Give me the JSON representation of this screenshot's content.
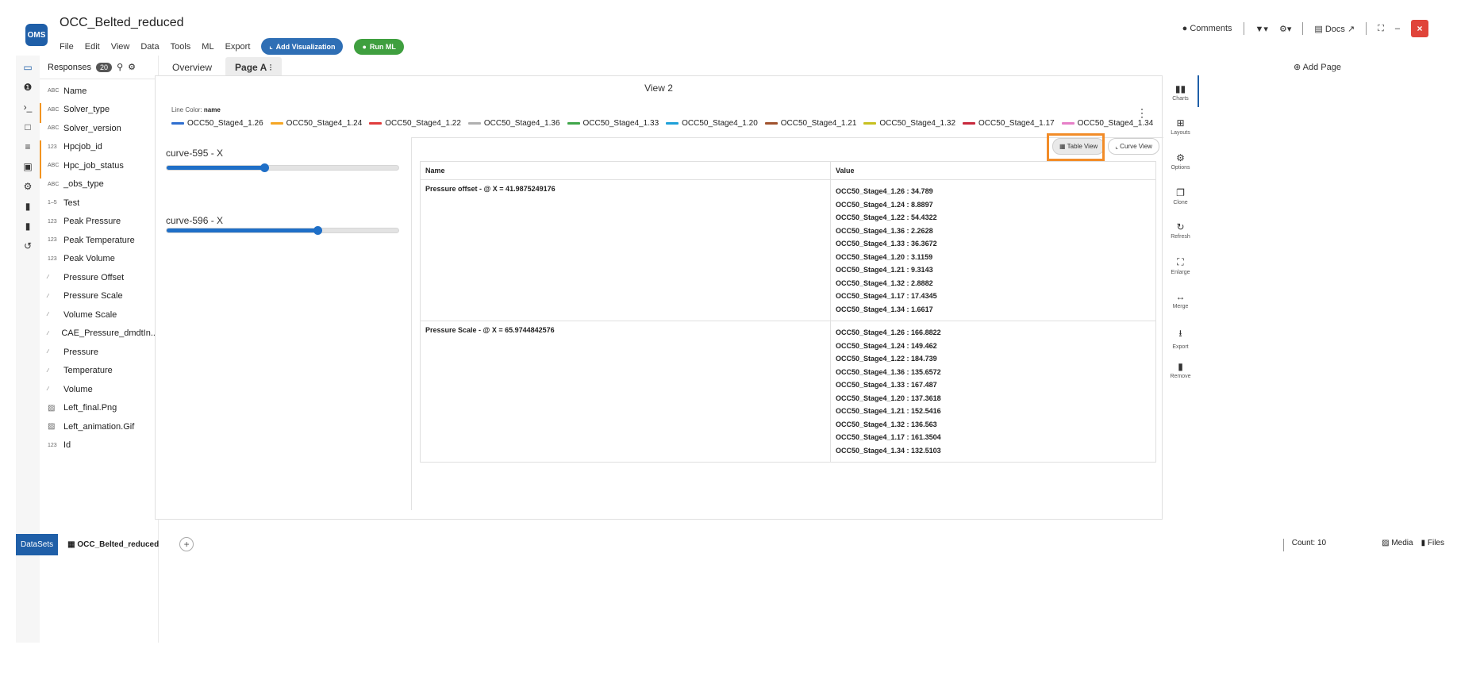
{
  "app": {
    "title": "OCC_Belted_reduced",
    "logo": "OMS"
  },
  "menu": [
    "File",
    "Edit",
    "View",
    "Data",
    "Tools",
    "ML",
    "Export"
  ],
  "header_buttons": {
    "add_visualization": "Add Visualization",
    "run_ml": "Run ML"
  },
  "top_right": {
    "comments": "Comments",
    "docs": "Docs"
  },
  "rail_icons": [
    "monitor-icon",
    "info-icon",
    "terminal-icon",
    "square-icon",
    "sliders-icon",
    "image-icon",
    "gear-icon",
    "file-icon",
    "file-icon",
    "history-icon"
  ],
  "fields_panel": {
    "label": "Responses",
    "count": "20",
    "items": [
      {
        "type": "ABC",
        "name": "Name"
      },
      {
        "type": "ABC",
        "name": "Solver_type"
      },
      {
        "type": "ABC",
        "name": "Solver_version"
      },
      {
        "type": "123",
        "name": "Hpcjob_id"
      },
      {
        "type": "ABC",
        "name": "Hpc_job_status"
      },
      {
        "type": "ABC",
        "name": "_obs_type"
      },
      {
        "type": "1–5",
        "name": "Test"
      },
      {
        "type": "123",
        "name": "Peak Pressure"
      },
      {
        "type": "123",
        "name": "Peak Temperature"
      },
      {
        "type": "123",
        "name": "Peak Volume"
      },
      {
        "type": "∕",
        "name": "Pressure Offset"
      },
      {
        "type": "∕",
        "name": "Pressure Scale"
      },
      {
        "type": "∕",
        "name": "Volume Scale"
      },
      {
        "type": "∕",
        "name": "CAE_Pressure_dmdtIn..."
      },
      {
        "type": "∕",
        "name": "Pressure"
      },
      {
        "type": "∕",
        "name": "Temperature"
      },
      {
        "type": "∕",
        "name": "Volume"
      },
      {
        "type": "img",
        "name": "Left_final.Png"
      },
      {
        "type": "img",
        "name": "Left_animation.Gif"
      },
      {
        "type": "123",
        "name": "Id"
      }
    ]
  },
  "tabs": [
    "Overview",
    "Page A"
  ],
  "add_page": "Add Page",
  "view": {
    "title": "View 2",
    "legend_caption_prefix": "Line Color:",
    "legend_caption_field": "name",
    "legend": [
      {
        "label": "OCC50_Stage4_1.26",
        "color": "#2f6fd0"
      },
      {
        "label": "OCC50_Stage4_1.24",
        "color": "#f5a623"
      },
      {
        "label": "OCC50_Stage4_1.22",
        "color": "#e03c3c"
      },
      {
        "label": "OCC50_Stage4_1.36",
        "color": "#b0b0b0"
      },
      {
        "label": "OCC50_Stage4_1.33",
        "color": "#3fa64a"
      },
      {
        "label": "OCC50_Stage4_1.20",
        "color": "#1ea0d8"
      },
      {
        "label": "OCC50_Stage4_1.21",
        "color": "#a0522d"
      },
      {
        "label": "OCC50_Stage4_1.32",
        "color": "#c8c020"
      },
      {
        "label": "OCC50_Stage4_1.17",
        "color": "#c8283c"
      },
      {
        "label": "OCC50_Stage4_1.34",
        "color": "#e67fc8"
      }
    ],
    "sliders": [
      {
        "label": "curve-595 - X",
        "fraction": 0.42
      },
      {
        "label": "curve-596 - X",
        "fraction": 0.65
      }
    ],
    "toggle": {
      "table_view": "Table View",
      "curve_view": "Curve View"
    },
    "table": {
      "headers": [
        "Name",
        "Value"
      ],
      "rows": [
        {
          "name": "Pressure offset - @ X = 41.9875249176",
          "values": [
            "OCC50_Stage4_1.26 : 34.789",
            "OCC50_Stage4_1.24 : 8.8897",
            "OCC50_Stage4_1.22 : 54.4322",
            "OCC50_Stage4_1.36 : 2.2628",
            "OCC50_Stage4_1.33 : 36.3672",
            "OCC50_Stage4_1.20 : 3.1159",
            "OCC50_Stage4_1.21 : 9.3143",
            "OCC50_Stage4_1.32 : 2.8882",
            "OCC50_Stage4_1.17 : 17.4345",
            "OCC50_Stage4_1.34 : 1.6617"
          ]
        },
        {
          "name": "Pressure Scale - @ X = 65.9744842576",
          "values": [
            "OCC50_Stage4_1.26 : 166.8822",
            "OCC50_Stage4_1.24 : 149.462",
            "OCC50_Stage4_1.22 : 184.739",
            "OCC50_Stage4_1.36 : 135.6572",
            "OCC50_Stage4_1.33 : 167.487",
            "OCC50_Stage4_1.20 : 137.3618",
            "OCC50_Stage4_1.21 : 152.5416",
            "OCC50_Stage4_1.32 : 136.563",
            "OCC50_Stage4_1.17 : 161.3504",
            "OCC50_Stage4_1.34 : 132.5103"
          ]
        }
      ]
    }
  },
  "right_toolbar": [
    {
      "label": "Charts",
      "icon": "bar-chart-icon"
    },
    {
      "label": "Layouts",
      "icon": "grid-icon"
    },
    {
      "label": "Options",
      "icon": "gear-icon"
    },
    {
      "label": "Clone",
      "icon": "copy-icon"
    },
    {
      "label": "Refresh",
      "icon": "refresh-icon"
    },
    {
      "label": "Enlarge",
      "icon": "expand-icon"
    },
    {
      "label": "Merge",
      "icon": "merge-icon"
    },
    {
      "label": "Export",
      "icon": "download-icon"
    },
    {
      "label": "Remove",
      "icon": "trash-icon"
    }
  ],
  "footer": {
    "datasets": "DataSets",
    "dataset_tab": "OCC_Belted_reduced",
    "count": "Count: 10",
    "media": "Media",
    "files": "Files"
  }
}
